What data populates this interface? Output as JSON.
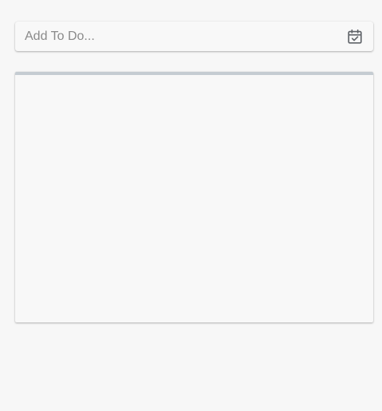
{
  "todo_input": {
    "placeholder": "Add To Do...",
    "value": ""
  },
  "date_button": {
    "icon": "calendar-check-icon",
    "color": "#5f6368"
  },
  "todo_list": {
    "progress": 0,
    "items": []
  },
  "colors": {
    "background": "#f7f7f7",
    "card": "#f8f8f8",
    "progress_track": "#c5ccd2"
  }
}
